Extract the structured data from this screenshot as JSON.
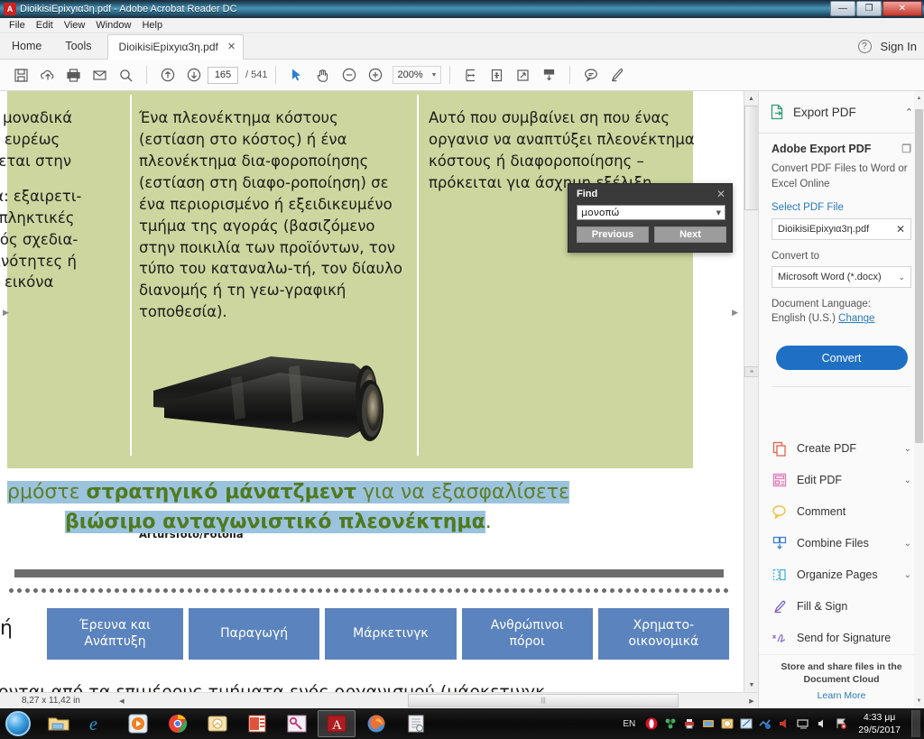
{
  "window": {
    "title": "DioikisiEpixyια3η.pdf - Adobe Acrobat Reader DC",
    "app_icon": "acrobat-icon",
    "minimize": "—",
    "maximize": "❐",
    "close": "✕"
  },
  "menu": {
    "items": [
      "File",
      "Edit",
      "View",
      "Window",
      "Help"
    ]
  },
  "tabs": {
    "home": "Home",
    "tools": "Tools",
    "document": "DioikisiEpixyια3η.pdf",
    "close_glyph": "✕",
    "help_glyph": "?",
    "sign_in": "Sign In"
  },
  "toolbar": {
    "save_label": "save-icon",
    "cloud_label": "upload-cloud-icon",
    "print_label": "print-icon",
    "email_label": "email-icon",
    "search_label": "search-icon",
    "prev_page": "▲",
    "next_page": "▼",
    "page_current": "165",
    "page_total": "/ 541",
    "select_tool": "select-cursor-icon",
    "hand_tool": "hand-icon",
    "zoom_out": "−",
    "zoom_in": "+",
    "zoom_value": "200%",
    "zoom_caret": "▼",
    "fit_width": "fit-width-icon",
    "fit_page": "fit-page-icon",
    "fullscreen": "fullscreen-icon",
    "scroll_mode": "scroll-mode-icon",
    "comment": "comment-icon",
    "highlight": "highlight-pen-icon"
  },
  "find_dialog": {
    "title": "Find",
    "close": "✕",
    "query": "μονοπώ",
    "dropdown_caret": "▼",
    "previous": "Previous",
    "next": "Next"
  },
  "pdf": {
    "column1": [
      "έρει μοναδικά",
      "νται ευρέως",
      "ιθύνεται στην"
    ],
    "column1b": [
      "όντα: εξαιρετι-",
      "ι, εκπληκτικές",
      "ομικός σχεδια-",
      "; ικανότητες ή",
      "τική εικόνα"
    ],
    "column2": "Ένα πλεονέκτημα κόστους (εστίαση στο κόστος) ή ένα πλεονέκτημα δια-φοροποίησης (εστίαση στη διαφο-ροποίηση) σε ένα περιορισμένο ή εξειδικευμένο τμήμα της αγοράς (βασιζόμενο στην ποικιλία των προϊόντων, τον τύπο του καταναλω-τή, τον δίαυλο διανομής ή τη γεω-γραφική τοποθεσία).",
    "column3": "Αυτό που συμβαίνει ση που ένας οργανισ να αναπτύξει πλεονέκτημα κόστους ή διαφοροποίησης – πρόκειται για άσχημη εξέλιξη.",
    "image_credit": "Artursfoto/Fotolia",
    "image_alt": "binoculars-photo",
    "heading_line1_pre": "ρμόστε ",
    "heading_line1_bold": "στρατηγικό μάνατζμεντ",
    "heading_line1_post": " για να εξασφαλίσετε",
    "heading_line2_bold": "βιώσιμο ανταγωνιστικό πλεονέκτημα",
    "heading_line2_post": ".",
    "left_stub": "ή",
    "boxes": [
      "Έρευνα και\nΑνάπτυξη",
      "Παραγωγή",
      "Μάρκετινγκ",
      "Ανθρώπινοι\nπόροι",
      "Χρηματο-\nοικονομικά"
    ],
    "bottom_text": "ονται από τα επιμέρους τμήματα ενός οργανισμού (μάρκετινγκ,",
    "page_size": "8,27 x 11,42 in",
    "accent_green_bg": "#ccd69e",
    "highlight_blue": "#9cc3dd",
    "heading_green": "#5d7f2a",
    "box_blue": "#5b83bd"
  },
  "right_panel": {
    "header_title": "Export PDF",
    "header_icon": "export-pdf-icon",
    "header_chevron": "⌃",
    "section_title": "Adobe Export PDF",
    "copy_icon": "copy-icon",
    "description": "Convert PDF Files to Word or Excel Online",
    "select_file_link": "Select PDF File",
    "file_name": "DioikisiEpixyια3η.pdf",
    "file_clear": "✕",
    "convert_to_label": "Convert to",
    "convert_to_value": "Microsoft Word (*.docx)",
    "convert_caret": "⌄",
    "language_label": "Document Language:",
    "language_value": "English (U.S.)",
    "language_change": "Change",
    "convert_button": "Convert",
    "tools": [
      {
        "label": "Create PDF",
        "icon": "create-pdf-icon",
        "chevron": "⌄",
        "color": "#e8604c"
      },
      {
        "label": "Edit PDF",
        "icon": "edit-pdf-icon",
        "chevron": "⌄",
        "color": "#e07bb8"
      },
      {
        "label": "Comment",
        "icon": "comment-icon",
        "chevron": "",
        "color": "#f0c040"
      },
      {
        "label": "Combine Files",
        "icon": "combine-files-icon",
        "chevron": "⌄",
        "color": "#3f7fd0"
      },
      {
        "label": "Organize Pages",
        "icon": "organize-pages-icon",
        "chevron": "⌄",
        "color": "#49b7d4"
      },
      {
        "label": "Fill & Sign",
        "icon": "fill-sign-icon",
        "chevron": "",
        "color": "#7a5fc4"
      },
      {
        "label": "Send for Signature",
        "icon": "send-signature-icon",
        "chevron": "",
        "color": "#8b6fd0"
      }
    ],
    "footer_line1": "Store and share files in the",
    "footer_line2": "Document Cloud",
    "footer_link": "Learn More",
    "accent_blue": "#1f6fc4"
  },
  "taskbar": {
    "start": "start-orb",
    "items": [
      "file-explorer-icon",
      "internet-explorer-icon",
      "media-player-icon",
      "google-chrome-icon",
      "outlook-icon",
      "powerpoint-icon",
      "keepass-icon",
      "adobe-reader-icon",
      "firefox-icon",
      "document-icon"
    ],
    "language": "EN",
    "tray_icons": [
      "opera-icon",
      "network-sync-icon",
      "printer-icon",
      "display-icon",
      "outlook-tray-icon",
      "snip-icon",
      "update-icon",
      "speaker-mute-icon",
      "screen-icon",
      "volume-icon",
      "flag-icon"
    ],
    "time": "4:33 μμ",
    "date": "29/5/2017"
  }
}
